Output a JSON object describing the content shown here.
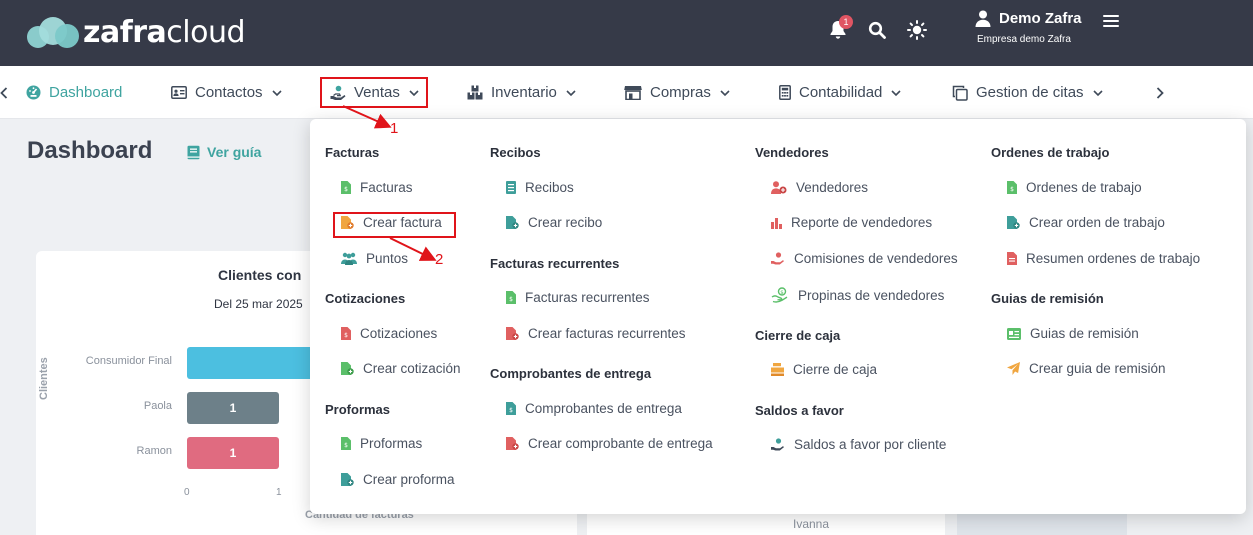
{
  "header": {
    "logo_bold": "zafra",
    "logo_light": "cloud",
    "notification_count": "1",
    "user_name": "Demo Zafra",
    "company": "Empresa demo Zafra"
  },
  "nav": {
    "items": [
      {
        "label": "Dashboard",
        "icon": "dashboard-gauge-icon",
        "active": true
      },
      {
        "label": "Contactos",
        "icon": "contact-card-icon"
      },
      {
        "label": "Ventas",
        "icon": "hand-coin-icon"
      },
      {
        "label": "Inventario",
        "icon": "boxes-icon"
      },
      {
        "label": "Compras",
        "icon": "store-icon"
      },
      {
        "label": "Contabilidad",
        "icon": "calculator-icon"
      },
      {
        "label": "Gestion de citas",
        "icon": "copy-window-icon"
      }
    ]
  },
  "page": {
    "title": "Dashboard",
    "guide_label": "Ver guía"
  },
  "chart_data": {
    "type": "bar",
    "orientation": "horizontal",
    "title": "Clientes con",
    "subtitle": "Del 25 mar 2025",
    "xlabel": "Cantidad de facturas",
    "ylabel": "Clientes",
    "categories": [
      "Consumidor Final",
      "Paola",
      "Ramon"
    ],
    "values": [
      2,
      1,
      1
    ],
    "value_labels": [
      "",
      "1",
      "1"
    ],
    "bar_colors": [
      "#4cbfe0",
      "#6d8089",
      "#e06b80"
    ],
    "x_ticks": [
      "0",
      "1"
    ],
    "xlim": [
      0,
      1.5
    ],
    "other_label": "Ivanna"
  },
  "annotations": {
    "step1": "1",
    "step2": "2"
  },
  "dropdown": {
    "col1": {
      "facturas": {
        "title": "Facturas",
        "items": [
          "Facturas",
          "Crear factura",
          "Puntos"
        ]
      },
      "cotizaciones": {
        "title": "Cotizaciones",
        "items": [
          "Cotizaciones",
          "Crear cotización"
        ]
      },
      "proformas": {
        "title": "Proformas",
        "items": [
          "Proformas",
          "Crear proforma"
        ]
      }
    },
    "col2": {
      "recibos": {
        "title": "Recibos",
        "items": [
          "Recibos",
          "Crear recibo"
        ]
      },
      "recurrentes": {
        "title": "Facturas recurrentes",
        "items": [
          "Facturas recurrentes",
          "Crear facturas recurrentes"
        ]
      },
      "comprobantes": {
        "title": "Comprobantes de entrega",
        "items": [
          "Comprobantes de entrega",
          "Crear comprobante de entrega"
        ]
      }
    },
    "col3": {
      "vendedores": {
        "title": "Vendedores",
        "items": [
          "Vendedores",
          "Reporte de vendedores",
          "Comisiones de vendedores",
          "Propinas de vendedores"
        ]
      },
      "cierre": {
        "title": "Cierre de caja",
        "items": [
          "Cierre de caja"
        ]
      },
      "saldos": {
        "title": "Saldos a favor",
        "items": [
          "Saldos a favor por cliente"
        ]
      }
    },
    "col4": {
      "ordenes": {
        "title": "Ordenes de trabajo",
        "items": [
          "Ordenes de trabajo",
          "Crear orden de trabajo",
          "Resumen ordenes de trabajo"
        ]
      },
      "guias": {
        "title": "Guias de remisión",
        "items": [
          "Guias de remisión",
          "Crear guia de remisión"
        ]
      }
    }
  },
  "colors": {
    "header_bg": "#363a48",
    "accent": "#3fa4a0",
    "highlight": "#e0141a",
    "icon_green": "#5bbf6a",
    "icon_orange": "#f0a640",
    "icon_red": "#e06060",
    "icon_teal": "#3e9e9a"
  }
}
